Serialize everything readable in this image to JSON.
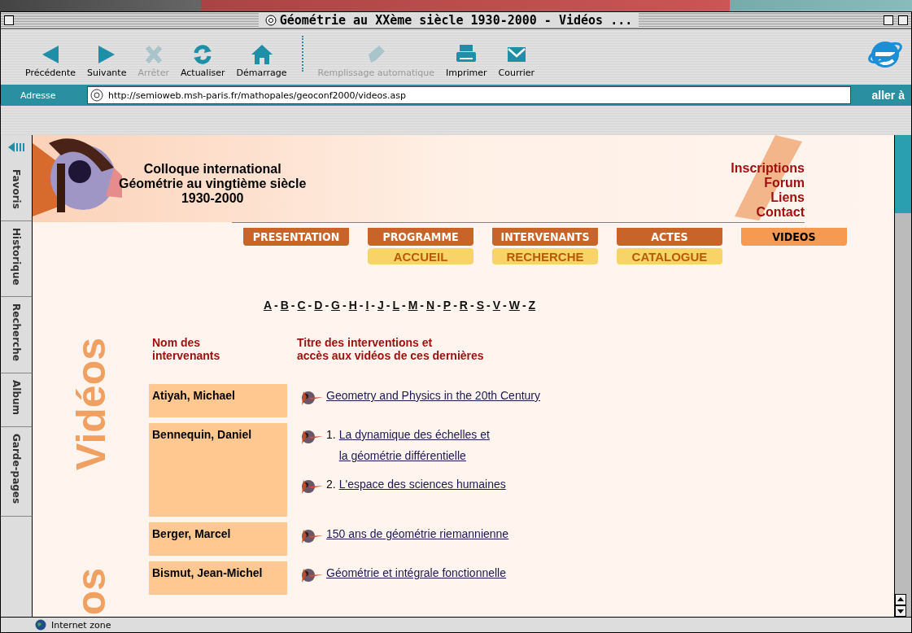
{
  "window": {
    "title": "Géométrie au XXème siècle 1930-2000 - Vidéos ..."
  },
  "toolbar": [
    {
      "label": "Précédente",
      "kind": "back",
      "disabled": false
    },
    {
      "label": "Suivante",
      "kind": "forward",
      "disabled": false
    },
    {
      "label": "Arrêter",
      "kind": "stop",
      "disabled": true
    },
    {
      "label": "Actualiser",
      "kind": "refresh",
      "disabled": false
    },
    {
      "label": "Démarrage",
      "kind": "home",
      "disabled": false
    },
    {
      "label": "Remplissage automatique",
      "kind": "autofill",
      "disabled": true
    },
    {
      "label": "Imprimer",
      "kind": "print",
      "disabled": false
    },
    {
      "label": "Courrier",
      "kind": "mail",
      "disabled": false
    }
  ],
  "address_bar": {
    "label": "Adresse",
    "value": "http://semioweb.msh-paris.fr/mathopales/geoconf2000/videos.asp",
    "go_button": "aller à"
  },
  "explorer_tabs": [
    "Favoris",
    "Historique",
    "Recherche",
    "Album",
    "Garde-pages"
  ],
  "page": {
    "header": {
      "title_lines": [
        "Colloque international",
        "Géométrie au vingtième siècle",
        "1930-2000"
      ],
      "links": [
        "Inscriptions",
        "Forum",
        "Liens",
        "Contact"
      ]
    },
    "nav": [
      {
        "label": "PRESENTATION",
        "selected": false
      },
      {
        "label": "PROGRAMME",
        "selected": false
      },
      {
        "label": "INTERVENANTS",
        "selected": false
      },
      {
        "label": "ACTES",
        "selected": false
      },
      {
        "label": "VIDEOS",
        "selected": true
      }
    ],
    "subnav": [
      "ACCUEIL",
      "RECHERCHE",
      "CATALOGUE"
    ],
    "alphabet": {
      "letters": [
        "A",
        "B",
        "C",
        "D",
        "G",
        "H",
        "I",
        "J",
        "L",
        "M",
        "N",
        "P",
        "R",
        "S",
        "V",
        "W",
        "Z"
      ],
      "separator": "-"
    },
    "section_title": "Vidéos",
    "section_title_repeat": "os",
    "table": {
      "columns": [
        "Nom des\nintervenants",
        "Titre des interventions et\naccès aux vidéos de ces dernières"
      ],
      "rows": [
        {
          "name": "Atiyah, Michael",
          "talks": [
            {
              "title": "Geometry and Physics in the 20th Century"
            }
          ]
        },
        {
          "name": "Bennequin, Daniel",
          "talks": [
            {
              "number": "1.",
              "title": "La dynamique des échelles et\nla géométrie différentielle"
            },
            {
              "number": "2.",
              "title": "L'espace des sciences humaines"
            }
          ]
        },
        {
          "name": "Berger, Marcel",
          "talks": [
            {
              "title": "150 ans de géométrie riemannienne"
            }
          ]
        },
        {
          "name": "Bismut, Jean-Michel",
          "talks": [
            {
              "title": "Géométrie et intégrale fonctionnelle"
            }
          ]
        }
      ]
    }
  },
  "status_bar": {
    "zone": "Internet zone"
  }
}
